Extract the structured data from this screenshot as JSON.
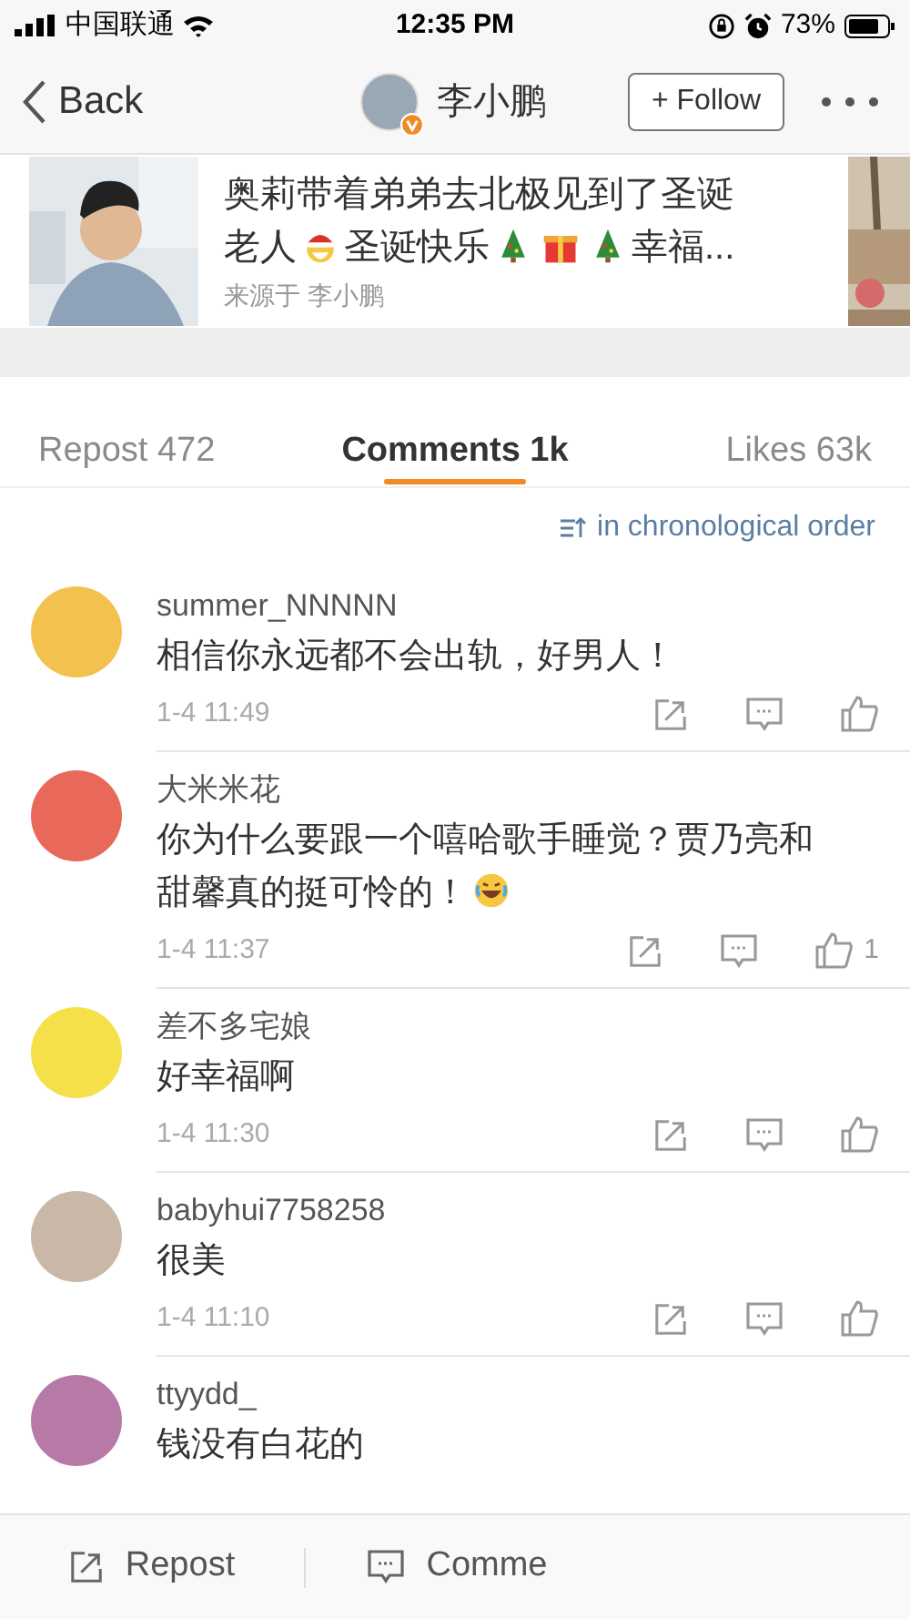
{
  "status_bar": {
    "carrier": "中国联通",
    "time": "12:35 PM",
    "battery": "73%"
  },
  "nav": {
    "back": "Back",
    "user": "李小鹏",
    "follow": "+ Follow",
    "verified": true
  },
  "post": {
    "title_parts": [
      {
        "kind": "text",
        "text": "奥莉带着弟弟去北极见到了圣诞"
      },
      {
        "kind": "text",
        "text": "老人"
      },
      {
        "kind": "santa"
      },
      {
        "kind": "text",
        "text": "圣诞快乐"
      },
      {
        "kind": "tree"
      },
      {
        "kind": "gift"
      },
      {
        "kind": "tree"
      },
      {
        "kind": "text",
        "text": "幸福..."
      }
    ],
    "source": "来源于 李小鹏"
  },
  "tabs": [
    {
      "label": "Repost 472",
      "selected": false
    },
    {
      "label": "Comments 1k",
      "selected": true
    },
    {
      "label": "Likes 63k",
      "selected": false
    }
  ],
  "sort": "in chronological order",
  "comments": [
    {
      "user": "summer_NNNNN",
      "color": "#f2c14e",
      "parts": [
        {
          "kind": "text",
          "text": "相信你永远都不会出轨，好男人！"
        }
      ],
      "time": "1-4 11:49"
    },
    {
      "user": "大米米花",
      "color": "#e8695a",
      "parts": [
        {
          "kind": "text",
          "text": "你为什么要跟一个嘻哈歌手睡觉？贾乃亮和"
        },
        {
          "kind": "text",
          "text": "甜馨真的挺可怜的！"
        },
        {
          "kind": "laugh"
        }
      ],
      "time": "1-4 11:37",
      "likes": "1"
    },
    {
      "user": "差不多宅娘",
      "color": "#f5e04a",
      "parts": [
        {
          "kind": "text",
          "text": "好幸福啊"
        }
      ],
      "time": "1-4 11:30"
    },
    {
      "user": "babyhui7758258",
      "color": "#c9b8a8",
      "parts": [
        {
          "kind": "text",
          "text": "很美"
        }
      ],
      "time": "1-4 11:10"
    },
    {
      "user": "ttyydd_",
      "color": "#b77aa6",
      "parts": [
        {
          "kind": "text",
          "text": "钱没有白花的"
        }
      ]
    }
  ],
  "bottom_bar": [
    {
      "kind": "repost",
      "label": "Repost"
    },
    {
      "kind": "comment",
      "label": "Comme"
    }
  ]
}
